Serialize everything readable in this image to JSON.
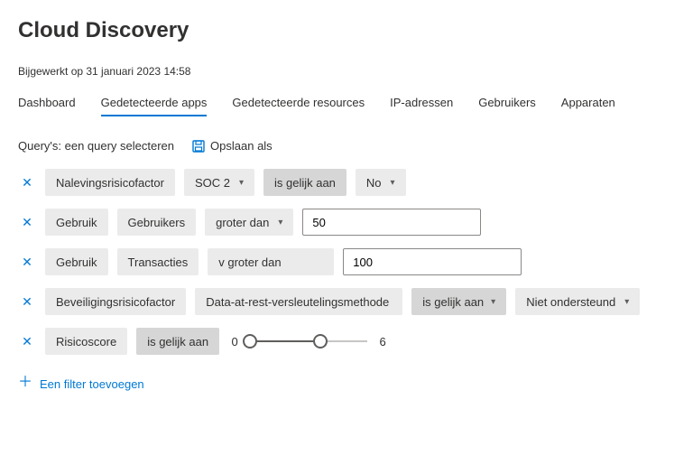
{
  "header": {
    "title": "Cloud Discovery",
    "updated": "Bijgewerkt op 31 januari 2023 14:58"
  },
  "tabs": [
    {
      "label": "Dashboard",
      "active": false
    },
    {
      "label": "Gedetecteerde apps",
      "active": true
    },
    {
      "label": "Gedetecteerde resources",
      "active": false
    },
    {
      "label": "IP-adressen",
      "active": false
    },
    {
      "label": "Gebruikers",
      "active": false
    },
    {
      "label": "Apparaten",
      "active": false
    }
  ],
  "query_bar": {
    "label": "Query's: een query selecteren",
    "save_as": "Opslaan als"
  },
  "filters": [
    {
      "field": "Nalevingsrisicofactor",
      "subfield": null,
      "subfield_select": "SOC 2",
      "operator": "is gelijk aan",
      "value_select": "No",
      "value_input": null
    },
    {
      "field": "Gebruik",
      "subfield": "Gebruikers",
      "subfield_select": null,
      "operator": "groter dan",
      "value_select": null,
      "value_input": "50"
    },
    {
      "field": "Gebruik",
      "subfield": "Transacties",
      "subfield_select": null,
      "operator": "v groter dan",
      "value_select": null,
      "value_input": "100"
    },
    {
      "field": "Beveiligingsrisicofactor",
      "subfield": null,
      "subfield_select": "Data-at-rest-versleutelingsmethode",
      "operator": "is gelijk aan",
      "value_select": "Niet ondersteund",
      "value_input": null,
      "operator_has_caret": true,
      "value_has_caret": true
    },
    {
      "field": "Risicoscore",
      "operator": "is gelijk aan",
      "range": {
        "min": 0,
        "max": 6,
        "scale_max": 10
      }
    }
  ],
  "add_filter_label": "Een filter toevoegen"
}
